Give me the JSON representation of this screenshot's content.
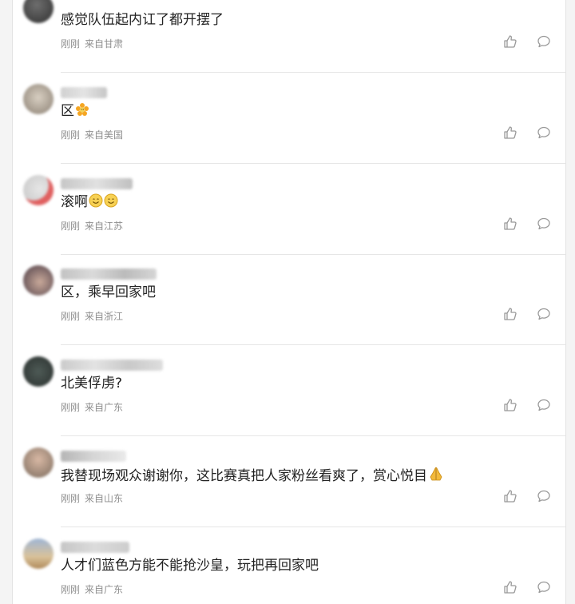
{
  "comments": [
    {
      "text": "感觉队伍起内讧了都开摆了",
      "time": "刚刚",
      "location": "来自甘肃"
    },
    {
      "text": "区",
      "emoji": [
        "flower-emoji"
      ],
      "time": "刚刚",
      "location": "来自美国"
    },
    {
      "text": "滚啊",
      "emoji": [
        "smile-emoji",
        "smile-emoji"
      ],
      "time": "刚刚",
      "location": "来自江苏"
    },
    {
      "text": "区，乘早回家吧",
      "time": "刚刚",
      "location": "来自浙江"
    },
    {
      "text": "北美俘虏?",
      "time": "刚刚",
      "location": "来自广东"
    },
    {
      "text": "我替现场观众谢谢你，这比赛真把人家粉丝看爽了，赏心悦目",
      "emoji": [
        "pray-emoji"
      ],
      "time": "刚刚",
      "location": "来自山东"
    },
    {
      "text": "人才们蓝色方能不能抢沙皇，玩把再回家吧",
      "time": "刚刚",
      "location": "来自广东"
    }
  ],
  "icons": {
    "like": "thumbs-up-icon",
    "reply": "speech-bubble-icon"
  },
  "colors": {
    "text": "#222222",
    "meta": "#8f8f8f",
    "icon": "#999999",
    "separator": "#e6e6e6"
  }
}
